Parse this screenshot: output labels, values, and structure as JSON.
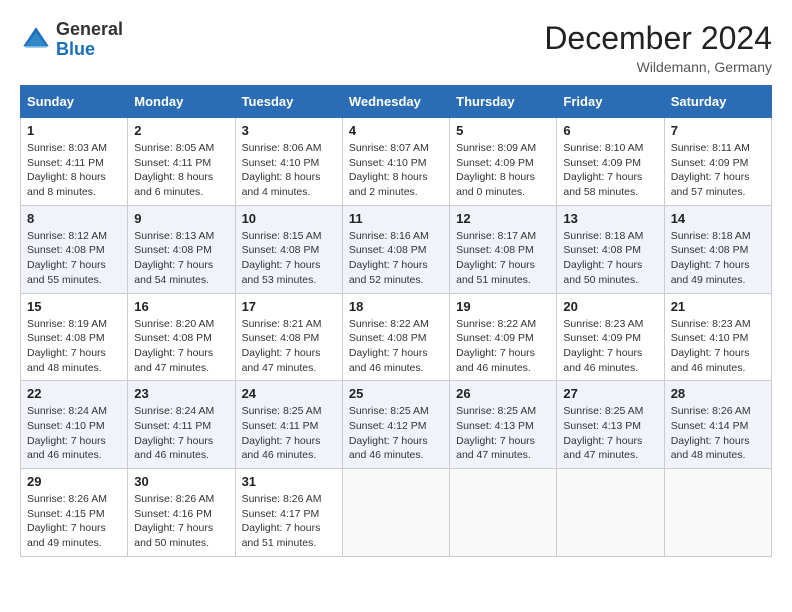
{
  "header": {
    "logo_general": "General",
    "logo_blue": "Blue",
    "month_year": "December 2024",
    "location": "Wildemann, Germany"
  },
  "days_of_week": [
    "Sunday",
    "Monday",
    "Tuesday",
    "Wednesday",
    "Thursday",
    "Friday",
    "Saturday"
  ],
  "weeks": [
    [
      {
        "day": "1",
        "sunrise": "8:03 AM",
        "sunset": "4:11 PM",
        "daylight": "8 hours and 8 minutes."
      },
      {
        "day": "2",
        "sunrise": "8:05 AM",
        "sunset": "4:11 PM",
        "daylight": "8 hours and 6 minutes."
      },
      {
        "day": "3",
        "sunrise": "8:06 AM",
        "sunset": "4:10 PM",
        "daylight": "8 hours and 4 minutes."
      },
      {
        "day": "4",
        "sunrise": "8:07 AM",
        "sunset": "4:10 PM",
        "daylight": "8 hours and 2 minutes."
      },
      {
        "day": "5",
        "sunrise": "8:09 AM",
        "sunset": "4:09 PM",
        "daylight": "8 hours and 0 minutes."
      },
      {
        "day": "6",
        "sunrise": "8:10 AM",
        "sunset": "4:09 PM",
        "daylight": "7 hours and 58 minutes."
      },
      {
        "day": "7",
        "sunrise": "8:11 AM",
        "sunset": "4:09 PM",
        "daylight": "7 hours and 57 minutes."
      }
    ],
    [
      {
        "day": "8",
        "sunrise": "8:12 AM",
        "sunset": "4:08 PM",
        "daylight": "7 hours and 55 minutes."
      },
      {
        "day": "9",
        "sunrise": "8:13 AM",
        "sunset": "4:08 PM",
        "daylight": "7 hours and 54 minutes."
      },
      {
        "day": "10",
        "sunrise": "8:15 AM",
        "sunset": "4:08 PM",
        "daylight": "7 hours and 53 minutes."
      },
      {
        "day": "11",
        "sunrise": "8:16 AM",
        "sunset": "4:08 PM",
        "daylight": "7 hours and 52 minutes."
      },
      {
        "day": "12",
        "sunrise": "8:17 AM",
        "sunset": "4:08 PM",
        "daylight": "7 hours and 51 minutes."
      },
      {
        "day": "13",
        "sunrise": "8:18 AM",
        "sunset": "4:08 PM",
        "daylight": "7 hours and 50 minutes."
      },
      {
        "day": "14",
        "sunrise": "8:18 AM",
        "sunset": "4:08 PM",
        "daylight": "7 hours and 49 minutes."
      }
    ],
    [
      {
        "day": "15",
        "sunrise": "8:19 AM",
        "sunset": "4:08 PM",
        "daylight": "7 hours and 48 minutes."
      },
      {
        "day": "16",
        "sunrise": "8:20 AM",
        "sunset": "4:08 PM",
        "daylight": "7 hours and 47 minutes."
      },
      {
        "day": "17",
        "sunrise": "8:21 AM",
        "sunset": "4:08 PM",
        "daylight": "7 hours and 47 minutes."
      },
      {
        "day": "18",
        "sunrise": "8:22 AM",
        "sunset": "4:08 PM",
        "daylight": "7 hours and 46 minutes."
      },
      {
        "day": "19",
        "sunrise": "8:22 AM",
        "sunset": "4:09 PM",
        "daylight": "7 hours and 46 minutes."
      },
      {
        "day": "20",
        "sunrise": "8:23 AM",
        "sunset": "4:09 PM",
        "daylight": "7 hours and 46 minutes."
      },
      {
        "day": "21",
        "sunrise": "8:23 AM",
        "sunset": "4:10 PM",
        "daylight": "7 hours and 46 minutes."
      }
    ],
    [
      {
        "day": "22",
        "sunrise": "8:24 AM",
        "sunset": "4:10 PM",
        "daylight": "7 hours and 46 minutes."
      },
      {
        "day": "23",
        "sunrise": "8:24 AM",
        "sunset": "4:11 PM",
        "daylight": "7 hours and 46 minutes."
      },
      {
        "day": "24",
        "sunrise": "8:25 AM",
        "sunset": "4:11 PM",
        "daylight": "7 hours and 46 minutes."
      },
      {
        "day": "25",
        "sunrise": "8:25 AM",
        "sunset": "4:12 PM",
        "daylight": "7 hours and 46 minutes."
      },
      {
        "day": "26",
        "sunrise": "8:25 AM",
        "sunset": "4:13 PM",
        "daylight": "7 hours and 47 minutes."
      },
      {
        "day": "27",
        "sunrise": "8:25 AM",
        "sunset": "4:13 PM",
        "daylight": "7 hours and 47 minutes."
      },
      {
        "day": "28",
        "sunrise": "8:26 AM",
        "sunset": "4:14 PM",
        "daylight": "7 hours and 48 minutes."
      }
    ],
    [
      {
        "day": "29",
        "sunrise": "8:26 AM",
        "sunset": "4:15 PM",
        "daylight": "7 hours and 49 minutes."
      },
      {
        "day": "30",
        "sunrise": "8:26 AM",
        "sunset": "4:16 PM",
        "daylight": "7 hours and 50 minutes."
      },
      {
        "day": "31",
        "sunrise": "8:26 AM",
        "sunset": "4:17 PM",
        "daylight": "7 hours and 51 minutes."
      },
      null,
      null,
      null,
      null
    ]
  ]
}
